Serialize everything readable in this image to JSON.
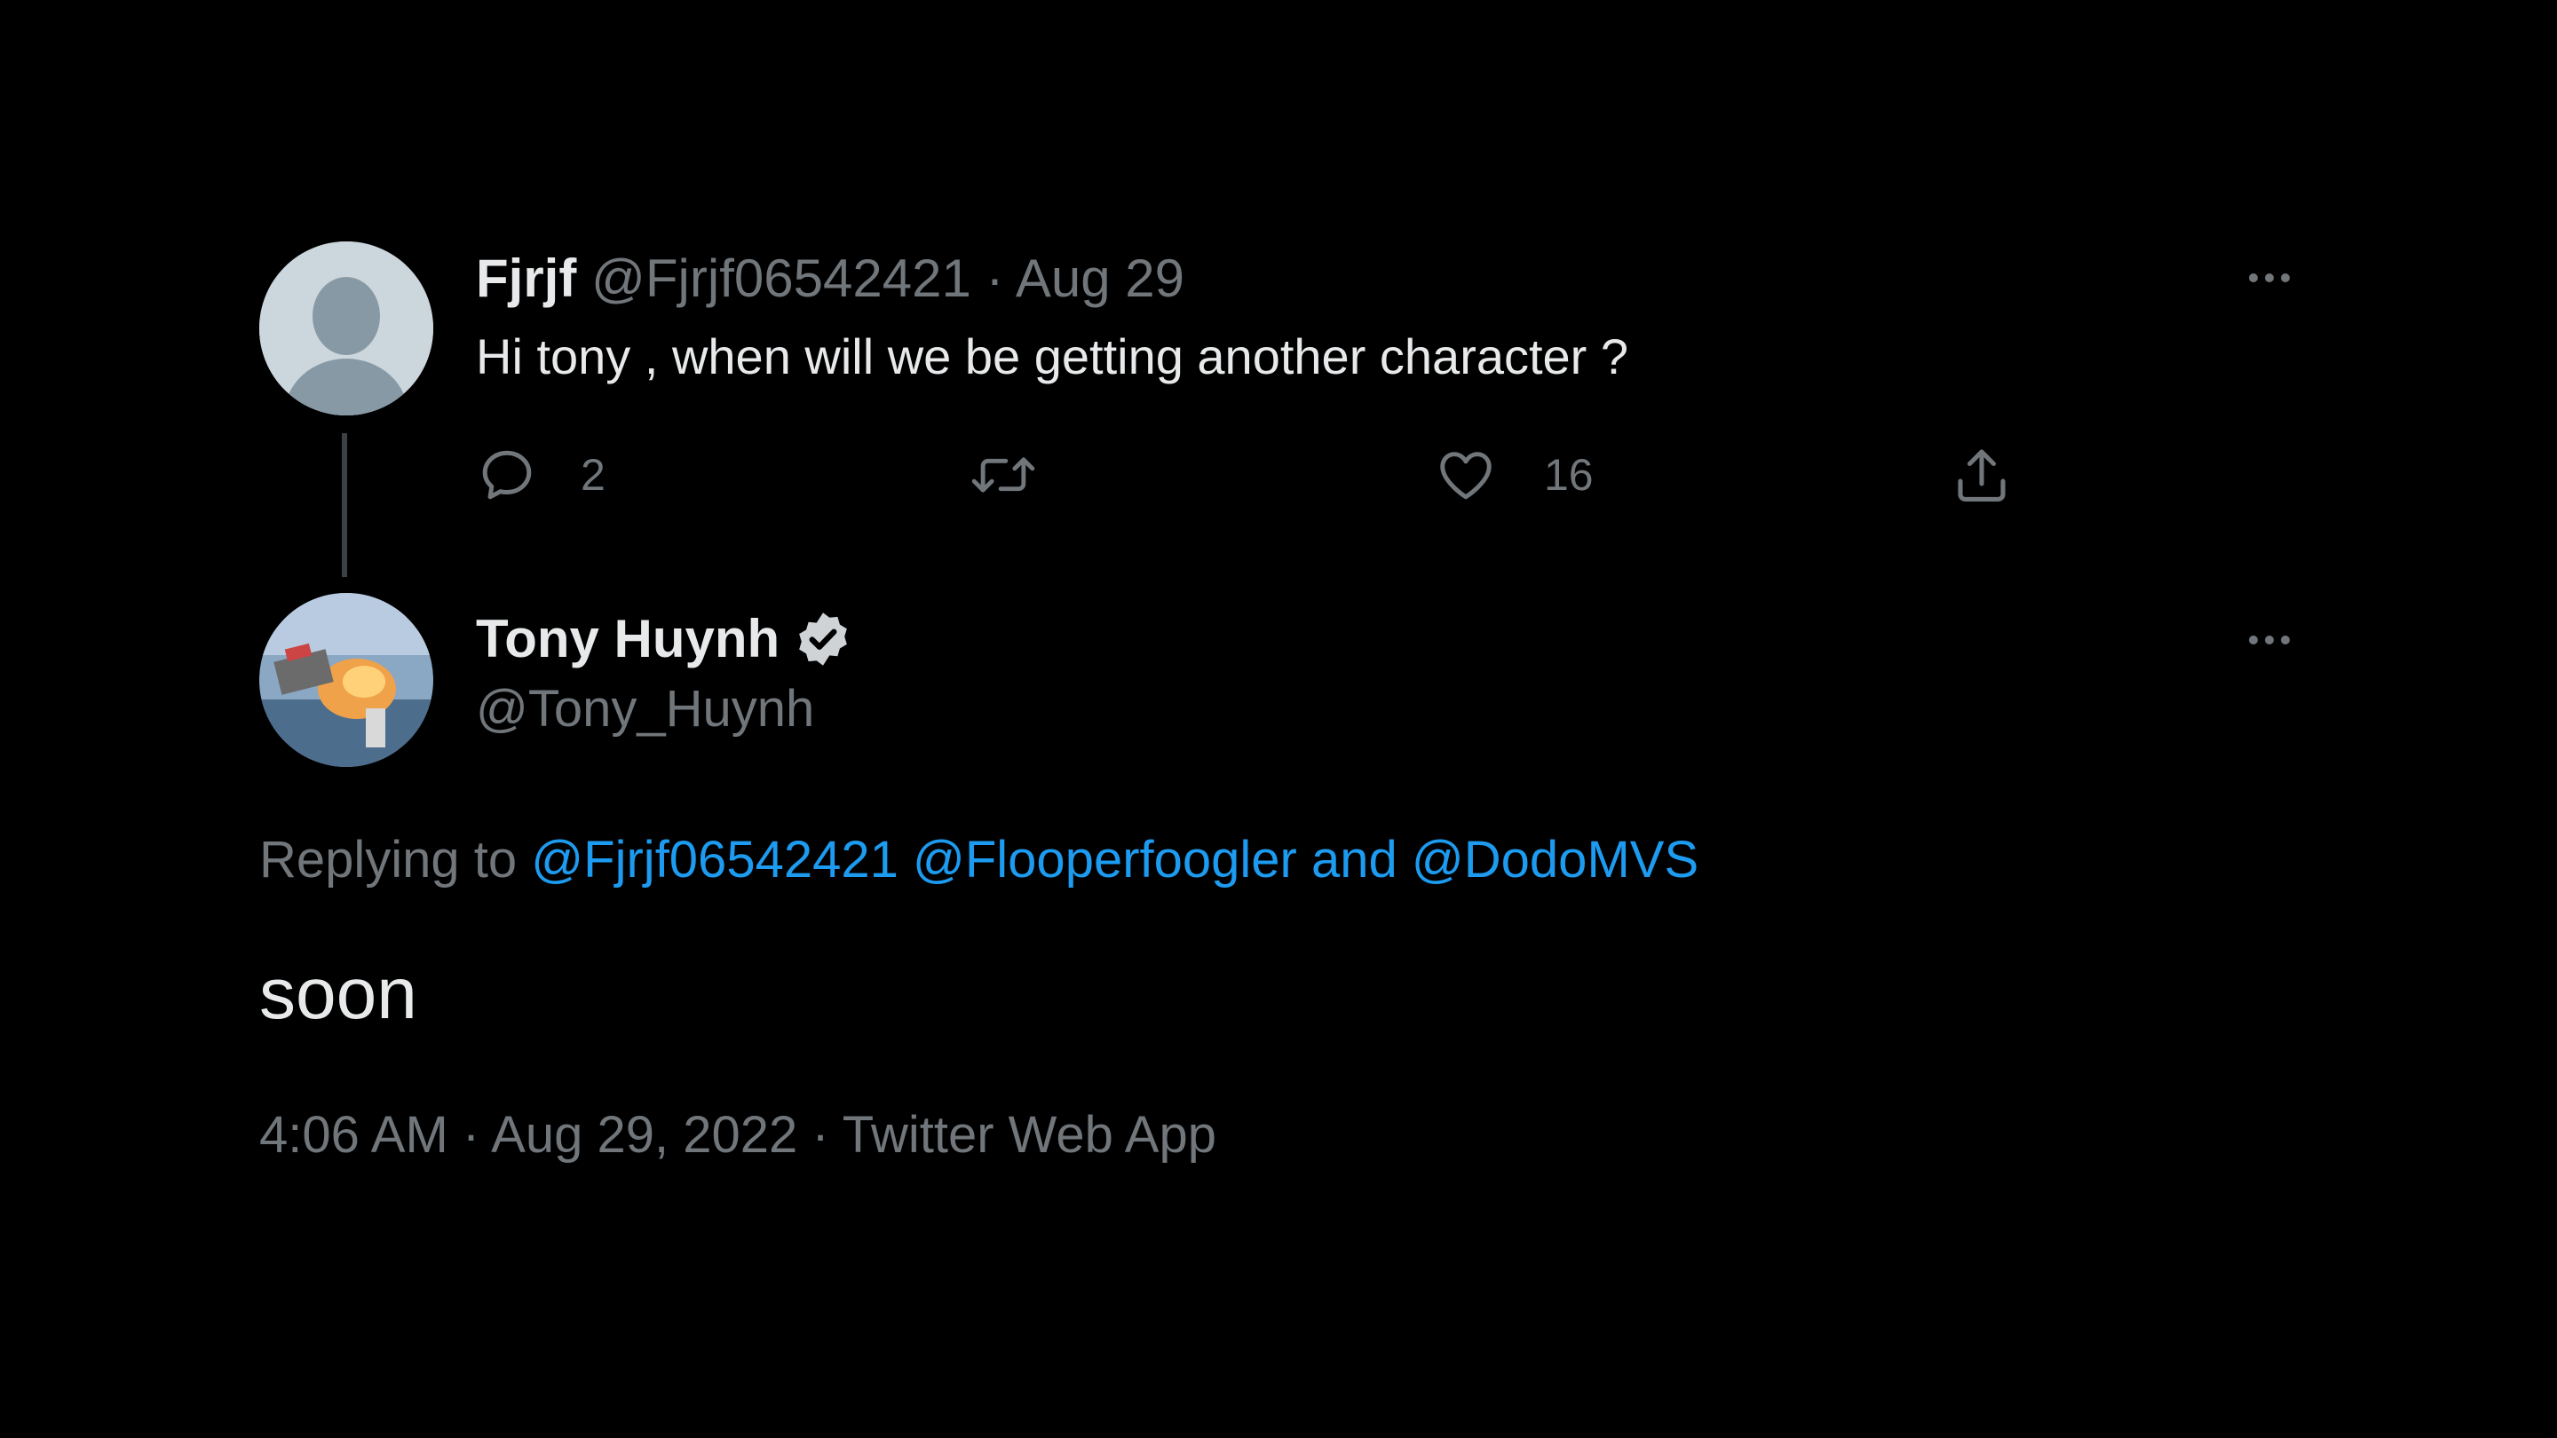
{
  "parent_tweet": {
    "author_name": "Fjrjf",
    "handle": "@Fjrjf06542421",
    "separator": "·",
    "date": "Aug 29",
    "text": "Hi tony , when will we be getting another character ?",
    "reply_count": "2",
    "like_count": "16",
    "icons": [
      "reply-icon",
      "retweet-icon",
      "like-icon",
      "share-icon",
      "more-icon"
    ]
  },
  "main_tweet": {
    "author_name": "Tony Huynh",
    "handle": "@Tony_Huynh",
    "replying_prefix": "Replying to",
    "mention_1": "@Fjrjf06542421",
    "mention_2": "@Flooperfoogler",
    "and_word": "and",
    "mention_3": "@DodoMVS",
    "text": "soon",
    "timestamp": "4:06 AM · Aug 29, 2022 · Twitter Web App",
    "icons": [
      "verified-badge-icon",
      "more-icon"
    ]
  },
  "colors": {
    "background": "#000000",
    "text": "#e7e9ea",
    "muted": "#71767b",
    "link": "#1d9bf0",
    "thread_line": "#3e4144"
  }
}
